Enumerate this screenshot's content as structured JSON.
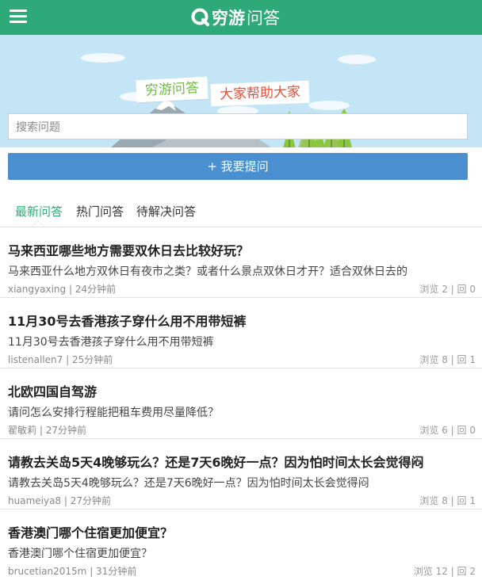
{
  "header": {
    "brand": "穷游",
    "sub": "问答",
    "bg_color": "#2eaa78"
  },
  "banner": {
    "ribbon_left": "穷游问答",
    "ribbon_right": "大家帮助大家"
  },
  "search": {
    "placeholder": "搜索问题"
  },
  "ask_button": {
    "label": "+ 我要提问",
    "color": "#4a90d0"
  },
  "tabs": [
    {
      "label": "最新问答",
      "active": true
    },
    {
      "label": "热门问答",
      "active": false
    },
    {
      "label": "待解决问答",
      "active": false
    }
  ],
  "questions": [
    {
      "title": "马来西亚哪些地方需要双休日去比较好玩？",
      "desc": "马来西亚什么地方双休日有夜市之类？或者什么景点双休日才开？适合双休日去的",
      "user": "xiangyaxing",
      "time": "24分钟前",
      "stats": "浏览 2 | 回 0"
    },
    {
      "title": "11月30号去香港孩子穿什么用不用带短裤",
      "desc": "11月30号去香港孩子穿什么用不用带短裤",
      "user": "listenallen7",
      "time": "25分钟前",
      "stats": "浏览 8 | 回 1"
    },
    {
      "title": "北欧四国自驾游",
      "desc": "请问怎么安排行程能把租车费用尽量降低？",
      "user": "翟敏莉",
      "time": "27分钟前",
      "stats": "浏览 6 | 回 0"
    },
    {
      "title": "请教去关岛5天4晚够玩么？还是7天6晚好一点？因为怕时间太长会觉得闷",
      "desc": "请教去关岛5天4晚够玩么？还是7天6晚好一点？因为怕时间太长会觉得闷",
      "user": "huameiya8",
      "time": "27分钟前",
      "stats": "浏览 8 | 回 1"
    },
    {
      "title": "香港澳门哪个住宿更加便宜？",
      "desc": "香港澳门哪个住宿更加便宜？",
      "user": "brucetian2015m",
      "time": "31分钟前",
      "stats": "浏览 12 | 回 2"
    }
  ]
}
